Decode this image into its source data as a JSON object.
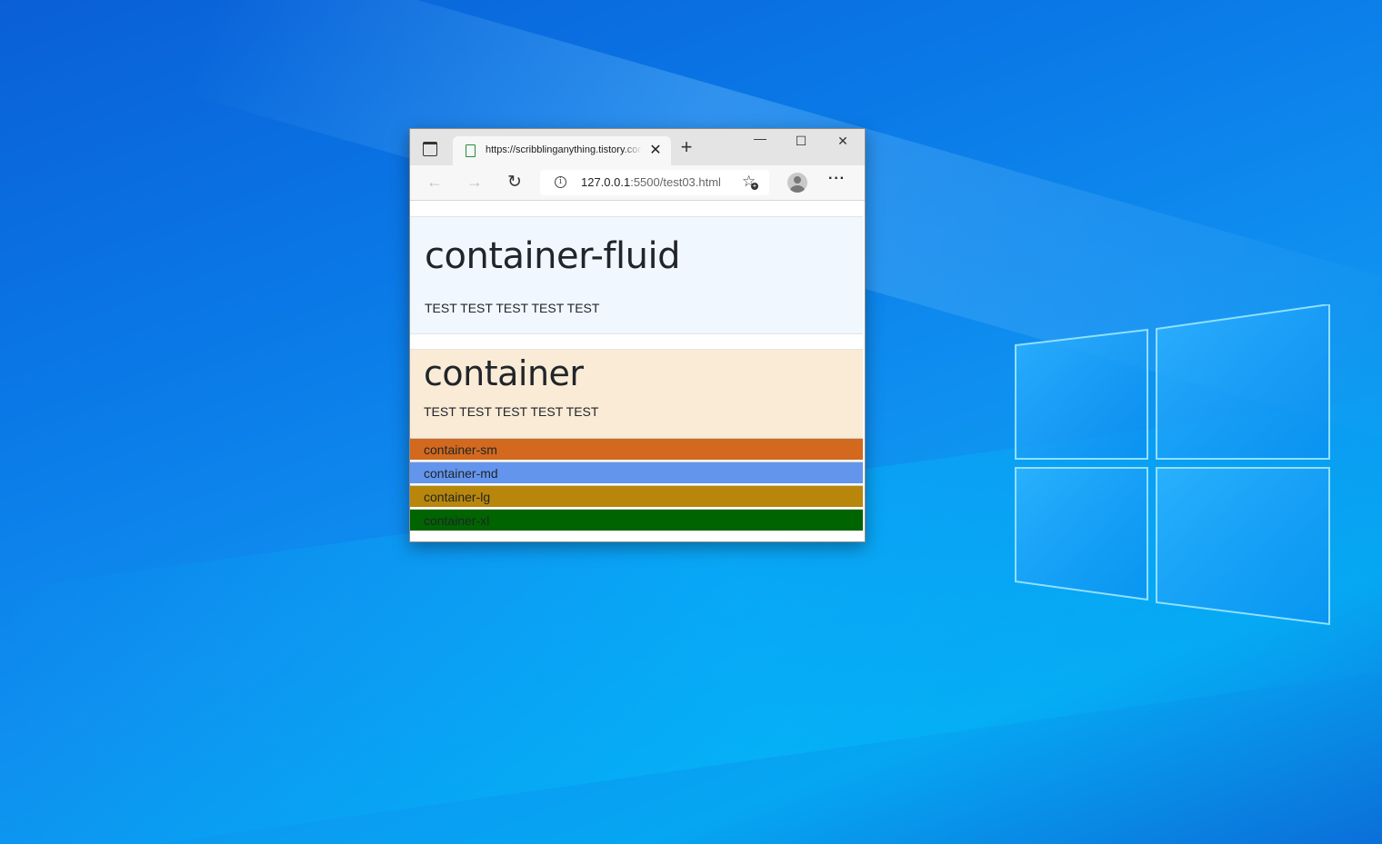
{
  "browser": {
    "tab": {
      "title": "https://scribblinganything.tistory.com"
    },
    "address": {
      "host": "127.0.0.1",
      "rest": ":5500/test03.html"
    },
    "controls": {
      "minimize": "—",
      "maximize": "☐",
      "close": "✕",
      "new_tab": "+",
      "more": "···"
    }
  },
  "page": {
    "fluid": {
      "heading": "container-fluid",
      "text": "TEST TEST TEST TEST TEST",
      "bg": "#f0f7ff"
    },
    "container": {
      "heading": "container",
      "text": "TEST TEST TEST TEST TEST",
      "bg": "#faebd7"
    },
    "bars": [
      {
        "label": "container-sm",
        "color": "#d2691e"
      },
      {
        "label": "container-md",
        "color": "#6495ed"
      },
      {
        "label": "container-lg",
        "color": "#b8860b"
      },
      {
        "label": "container-xl",
        "color": "#006400"
      }
    ]
  },
  "icons": {
    "tab_actions": "tab-actions-icon",
    "favicon": "page-icon",
    "back": "arrow-left-icon",
    "forward": "arrow-right-icon",
    "refresh": "refresh-icon",
    "info": "info-icon",
    "favorites": "star-plus-icon",
    "profile": "profile-icon"
  }
}
